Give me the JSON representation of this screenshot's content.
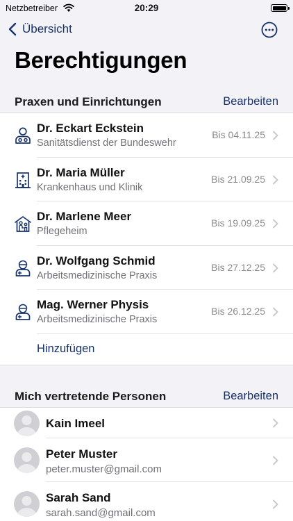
{
  "status": {
    "carrier": "Netzbetreiber",
    "time": "20:29"
  },
  "nav": {
    "back_label": "Übersicht"
  },
  "page_title": "Berechtigungen",
  "institutions": {
    "header": "Praxen und Einrichtungen",
    "edit_label": "Bearbeiten",
    "items": [
      {
        "icon": "paramedic-icon",
        "name": "Dr. Eckart Eckstein",
        "type": "Sanitätsdienst der Bundeswehr",
        "valid": "Bis 04.11.25"
      },
      {
        "icon": "hospital-icon",
        "name": "Dr. Maria Müller",
        "type": "Krankenhaus und Klinik",
        "valid": "Bis 21.09.25"
      },
      {
        "icon": "care-home-icon",
        "name": "Dr. Marlene Meer",
        "type": "Pflegeheim",
        "valid": "Bis 19.09.25"
      },
      {
        "icon": "occupational-doctor-icon",
        "name": "Dr. Wolfgang Schmid",
        "type": "Arbeitsmedizinische Praxis",
        "valid": "Bis 27.12.25"
      },
      {
        "icon": "occupational-doctor-icon",
        "name": "Mag. Werner Physis",
        "type": "Arbeitsmedizinische Praxis",
        "valid": "Bis 26.12.25"
      }
    ],
    "add_label": "Hinzufügen"
  },
  "representatives": {
    "header": "Mich vertretende Personen",
    "edit_label": "Bearbeiten",
    "items": [
      {
        "name": "Kain Imeel",
        "email": ""
      },
      {
        "name": "Peter Muster",
        "email": "peter.muster@gmail.com"
      },
      {
        "name": "Sarah Sand",
        "email": "sarah.sand@gmail.com"
      }
    ]
  }
}
